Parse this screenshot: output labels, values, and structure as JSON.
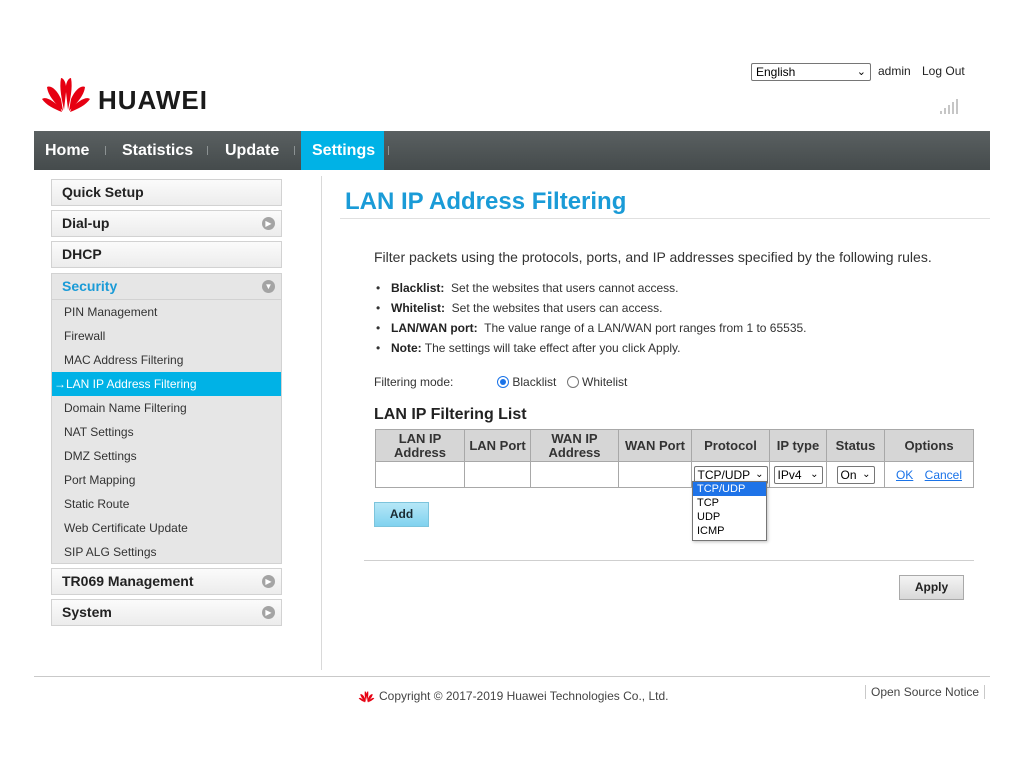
{
  "brand": {
    "name": "HUAWEI"
  },
  "header": {
    "language": "English",
    "user": "admin",
    "logout": "Log Out"
  },
  "nav": {
    "items": [
      {
        "label": "Home",
        "active": false
      },
      {
        "label": "Statistics",
        "active": false
      },
      {
        "label": "Update",
        "active": false
      },
      {
        "label": "Settings",
        "active": true
      }
    ]
  },
  "sidebar": {
    "sections": [
      {
        "label": "Quick Setup",
        "icon": "none"
      },
      {
        "label": "Dial-up",
        "icon": "chevron-right-icon"
      },
      {
        "label": "DHCP",
        "icon": "none"
      },
      {
        "label": "Security",
        "icon": "chevron-down-icon",
        "expanded": true
      },
      {
        "label": "TR069 Management",
        "icon": "chevron-right-icon"
      },
      {
        "label": "System",
        "icon": "chevron-right-icon"
      }
    ],
    "security_items": [
      "PIN Management",
      "Firewall",
      "MAC Address Filtering",
      "LAN IP Address Filtering",
      "Domain Name Filtering",
      "NAT Settings",
      "DMZ Settings",
      "Port Mapping",
      "Static Route",
      "Web Certificate Update",
      "SIP ALG Settings"
    ],
    "active_marker": "→"
  },
  "main": {
    "title": "LAN IP Address Filtering",
    "intro": "Filter packets using the protocols, ports, and IP addresses specified by the following rules.",
    "notes": [
      {
        "term": "Blacklist:",
        "text": "Set the websites that users cannot access."
      },
      {
        "term": "Whitelist:",
        "text": "Set the websites that users can access."
      },
      {
        "term": "LAN/WAN port:",
        "text": "The value range of a LAN/WAN port ranges from 1 to 65535."
      },
      {
        "term": "Note:",
        "text": "The settings will take effect after you click Apply."
      }
    ],
    "filtering_mode": {
      "label": "Filtering mode:",
      "options": [
        "Blacklist",
        "Whitelist"
      ],
      "selected": "Blacklist"
    },
    "list_title": "LAN IP Filtering List",
    "table": {
      "headers": [
        "LAN IP Address",
        "LAN Port",
        "WAN IP Address",
        "WAN Port",
        "Protocol",
        "IP type",
        "Status",
        "Options"
      ],
      "row": {
        "protocol": "TCP/UDP",
        "ip_type": "IPv4",
        "status": "On",
        "ok": "OK",
        "cancel": "Cancel"
      }
    },
    "protocol_options": [
      "TCP/UDP",
      "TCP",
      "UDP",
      "ICMP"
    ],
    "add_button": "Add",
    "apply_button": "Apply"
  },
  "footer": {
    "copyright": "Copyright © 2017-2019 Huawei Technologies Co., Ltd.",
    "oss": "Open Source Notice"
  },
  "colors": {
    "accent": "#00b2e6",
    "title": "#1a9bd7",
    "brand_red": "#e60012"
  }
}
